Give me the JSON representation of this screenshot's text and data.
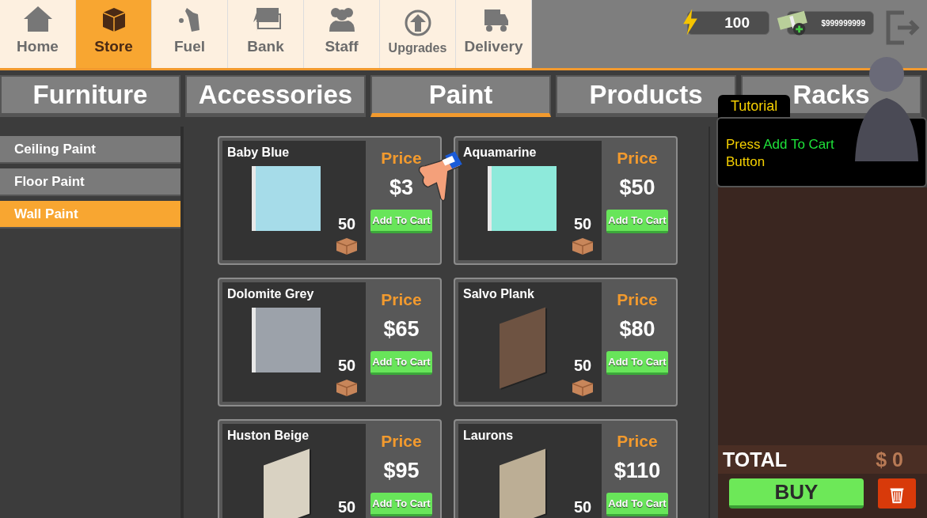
{
  "nav": [
    {
      "label": "Home",
      "kind": "home",
      "selected": false
    },
    {
      "label": "Store",
      "kind": "store",
      "selected": true
    },
    {
      "label": "Fuel",
      "kind": "fuel",
      "selected": false
    },
    {
      "label": "Bank",
      "kind": "bank",
      "selected": false
    },
    {
      "label": "Staff",
      "kind": "staff",
      "selected": false
    },
    {
      "label": "Upgrades",
      "kind": "upgrades",
      "selected": false
    },
    {
      "label": "Delivery",
      "kind": "delivery",
      "selected": false
    }
  ],
  "energy": {
    "value": "100"
  },
  "money": {
    "value": "$999999999"
  },
  "categories": [
    {
      "label": "Furniture",
      "selected": false
    },
    {
      "label": "Accessories",
      "selected": false
    },
    {
      "label": "Paint",
      "selected": true
    },
    {
      "label": "Products",
      "selected": false
    },
    {
      "label": "Racks",
      "selected": false
    }
  ],
  "sidebar": [
    {
      "label": "Ceiling Paint",
      "selected": false
    },
    {
      "label": "Floor Paint",
      "selected": false
    },
    {
      "label": "Wall Paint",
      "selected": true
    }
  ],
  "products": [
    {
      "name": "Baby Blue",
      "kind": "panel",
      "color": "#a6dce9",
      "quantity": "50",
      "price_label": "Price",
      "price": "$3",
      "button": "Add To Cart"
    },
    {
      "name": "Aquamarine",
      "kind": "panel",
      "color": "#8eeadb",
      "quantity": "50",
      "price_label": "Price",
      "price": "$50",
      "button": "Add To Cart"
    },
    {
      "name": "Dolomite Grey",
      "kind": "panel",
      "color": "#9ca2aa",
      "quantity": "50",
      "price_label": "Price",
      "price": "$65",
      "button": "Add To Cart"
    },
    {
      "name": "Salvo Plank",
      "kind": "tile",
      "color": "#6e5342",
      "quantity": "50",
      "price_label": "Price",
      "price": "$80",
      "button": "Add To Cart"
    },
    {
      "name": "Huston Beige",
      "kind": "tile",
      "color": "#d9d2c2",
      "quantity": "50",
      "price_label": "Price",
      "price": "$95",
      "button": "Add To Cart"
    },
    {
      "name": "Laurons",
      "kind": "tile",
      "color": "#bcae95",
      "quantity": "50",
      "price_label": "Price",
      "price": "$110",
      "button": "Add To Cart"
    }
  ],
  "tutorial": {
    "title": "Tutorial",
    "message": [
      {
        "text": "Press ",
        "highlight": false
      },
      {
        "text": "Add To Cart",
        "highlight": true
      },
      {
        "text": " Button",
        "highlight": false
      }
    ]
  },
  "cart": {
    "total_label": "TOTAL",
    "total": "$ 0",
    "buy": "BUY"
  }
}
